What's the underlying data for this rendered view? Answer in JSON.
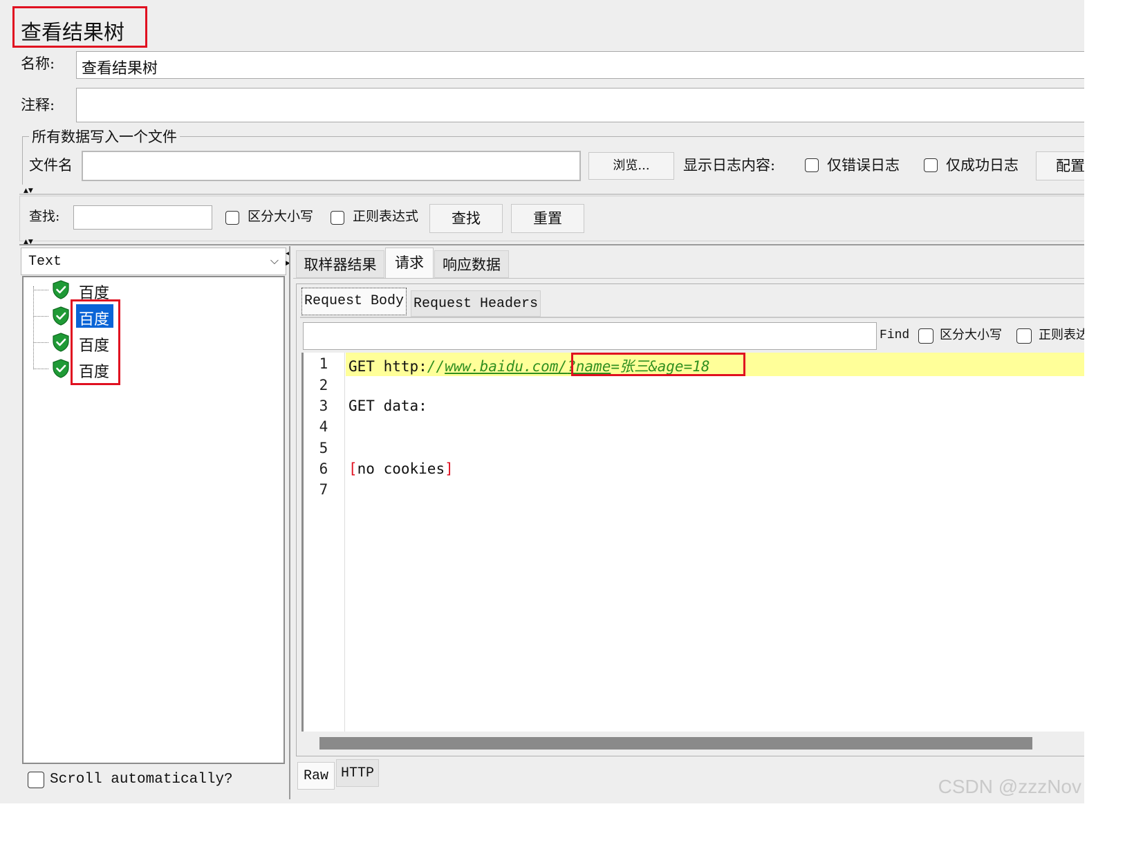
{
  "panel_title": "查看结果树",
  "form": {
    "name_label": "名称:",
    "name_value": "查看结果树",
    "comment_label": "注释:",
    "comment_value": ""
  },
  "file_group": {
    "legend": "所有数据写入一个文件",
    "filename_label": "文件名",
    "filename_value": "",
    "browse_button": "浏览...",
    "log_display_label": "显示日志内容:",
    "errors_only_label": "仅错误日志",
    "success_only_label": "仅成功日志",
    "config_button": "配置"
  },
  "search_bar": {
    "label": "查找:",
    "value": "",
    "case_sensitive_label": "区分大小写",
    "regex_label": "正则表达式",
    "search_button": "查找",
    "reset_button": "重置"
  },
  "left_panel": {
    "renderer_select": "Text",
    "tree_items": [
      "百度",
      "百度",
      "百度",
      "百度"
    ],
    "selected_index": 1,
    "scroll_auto_label": "Scroll automatically?"
  },
  "right_panel": {
    "tabs": [
      "取样器结果",
      "请求",
      "响应数据"
    ],
    "active_tab": "请求",
    "subtabs": [
      "Request Body",
      "Request Headers"
    ],
    "active_subtab": "Request Body",
    "find_label": "Find",
    "find_value": "",
    "find_case_label": "区分大小写",
    "find_regex_label": "正则表达",
    "code_lines": [
      "1",
      "2",
      "3",
      "4",
      "5",
      "6",
      "7"
    ],
    "code": {
      "line1_method": "GET ",
      "line1_scheme": "http:",
      "line1_slashes": "//",
      "line1_host": "www.baidu.com",
      "line1_sep": "/",
      "line1_query_key1": "?name",
      "line1_query_eq1": "=",
      "line1_query_val1": "张三",
      "line1_query_rest": "&age=18",
      "line3": "GET data:",
      "line6_open": "[",
      "line6_text": "no cookies",
      "line6_close": "]"
    },
    "bottom_tabs": [
      "Raw",
      "HTTP"
    ]
  },
  "watermark": "CSDN @zzzNov",
  "colors": {
    "highlight_line": "#ffff99",
    "annotation_red": "#e01020",
    "selection_blue": "#0a64d6",
    "url_green": "#2f8f1f"
  }
}
